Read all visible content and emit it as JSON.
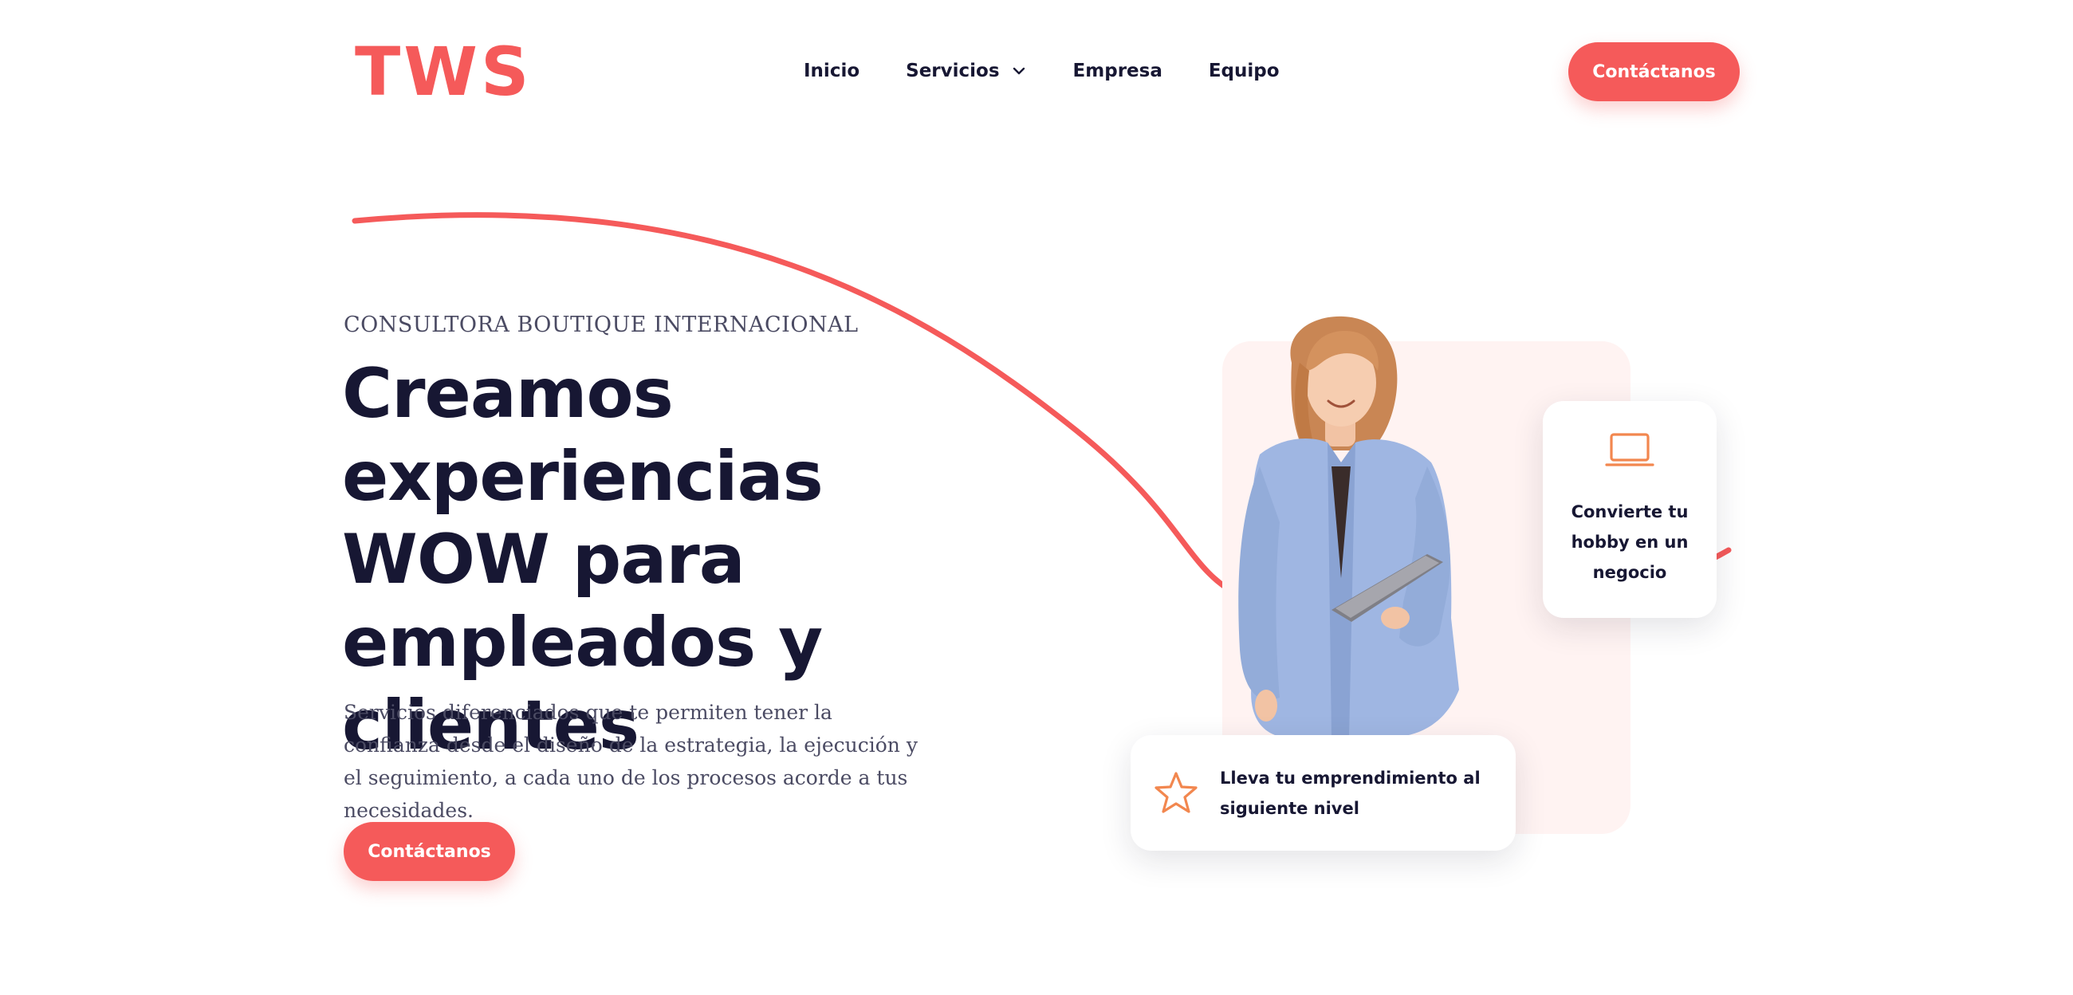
{
  "brand": {
    "logo_text": "TWS",
    "accent_color": "#f55a5a",
    "text_color": "#171733"
  },
  "nav": {
    "items": [
      {
        "label": "Inicio"
      },
      {
        "label": "Servicios",
        "has_dropdown": true
      },
      {
        "label": "Empresa"
      },
      {
        "label": "Equipo"
      }
    ],
    "cta_label": "Contáctanos"
  },
  "hero": {
    "eyebrow": "CONSULTORA BOUTIQUE INTERNACIONAL",
    "headline": "Creamos experiencias WOW para empleados y clientes",
    "subtext": "Servicios diferenciados que te permiten tener la confianza desde el diseño de la estrategia, la ejecución y el seguimiento, a cada uno de los procesos acorde a tus necesidades.",
    "cta_label": "Contáctanos"
  },
  "cards": {
    "hobby": {
      "icon": "laptop-icon",
      "text": "Convierte tu hobby en un negocio"
    },
    "level": {
      "icon": "star-icon",
      "text": "Lleva tu emprendimiento al siguiente nivel"
    }
  },
  "icon_color": "#f2874f"
}
